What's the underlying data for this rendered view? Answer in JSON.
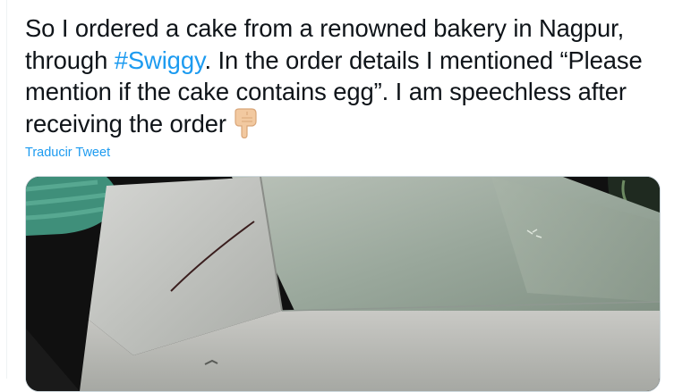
{
  "tweet": {
    "text_before_hashtag": "So I ordered a cake from a renowned bakery in Nagpur, through ",
    "hashtag": "#Swiggy",
    "text_after_hashtag": ". In the order details I mentioned “Please mention if the cake contains egg”. I am speechless after receiving the order",
    "emoji": "backhand-index-pointing-down",
    "translate_label": "Traducir Tweet"
  },
  "media": {
    "type": "photo",
    "subject": "cake-box-interior"
  },
  "colors": {
    "text": "#0f1419",
    "link": "#1d9bf0",
    "border": "#cfd9de",
    "skin_tone": "#f2c9a0"
  }
}
